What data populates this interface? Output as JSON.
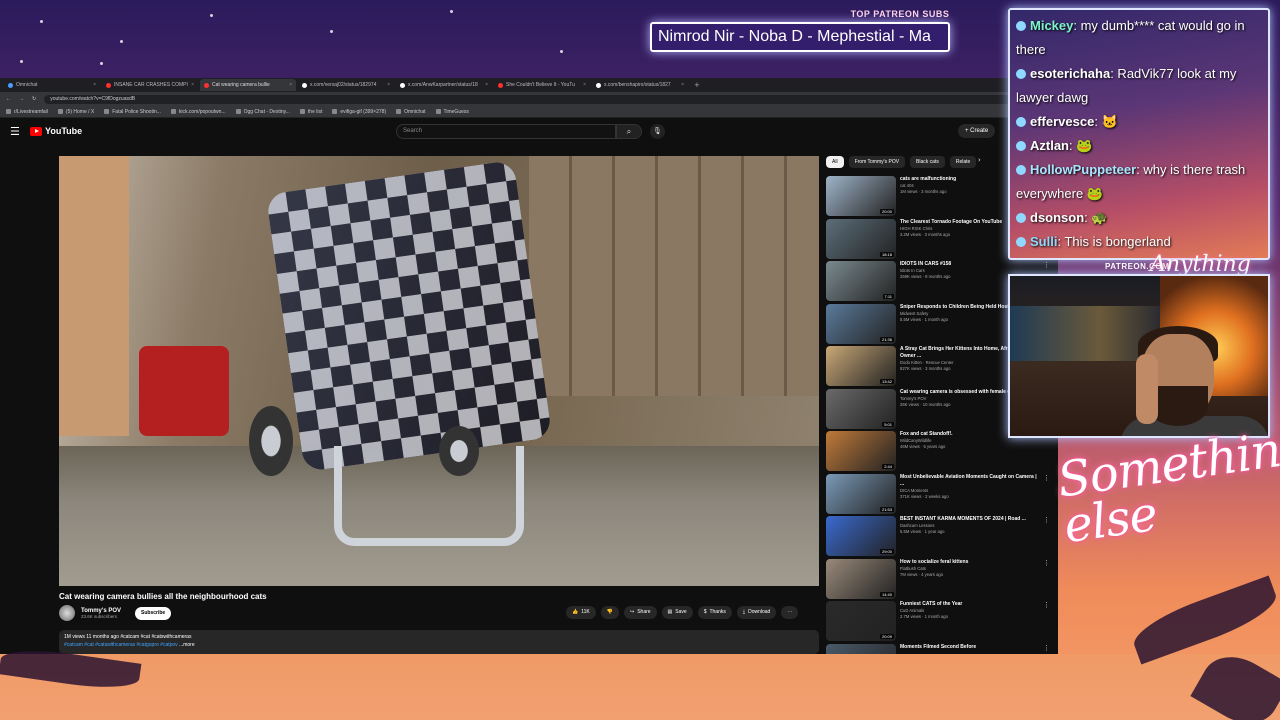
{
  "overlay": {
    "patreon_heading": "TOP PATREON SUBS",
    "patreon_names": "Nimrod Nir - Noba D - Mephestial - Ma",
    "patreon_url": "PATREON.COM/",
    "signature": "Something else",
    "signature_small": "Anything else?"
  },
  "browser": {
    "tabs": [
      {
        "label": "Omnichat",
        "icon": "globe-icon",
        "active": false
      },
      {
        "label": "INSANE CAR CRASHES COMPI",
        "icon": "youtube-icon",
        "active": false
      },
      {
        "label": "Cat wearing camera bullie",
        "icon": "youtube-icon",
        "active": true
      },
      {
        "label": "x.com/versaj02/status/182974",
        "icon": "x-icon",
        "active": false
      },
      {
        "label": "x.com/AnwKarpartner/status/18",
        "icon": "x-icon",
        "active": false
      },
      {
        "label": "She Couldn't Believe It - YouTu",
        "icon": "youtube-icon",
        "active": false
      },
      {
        "label": "x.com/benshapiro/status/1827",
        "icon": "x-icon",
        "active": false
      }
    ],
    "url": "youtube.com/watch?v=C9fDogzuasdB",
    "bookmarks": [
      "r/Livestreamfail",
      "(5) Home / X",
      "Fatal Police Shootin...",
      "kick.com/popoutwn...",
      "Ogg Chat - Destiny...",
      "the list",
      "evifiga-gif (399×278)",
      "Omnichat",
      "TimeGuess"
    ]
  },
  "youtube": {
    "logo": "YouTube",
    "search_placeholder": "Search",
    "create_label": "Create",
    "video_title": "Cat wearing camera bullies all the neighbourhood cats",
    "channel_name": "Tommy's POV",
    "channel_subs": "23.6K subscribers",
    "subscribe_label": "Subscribe",
    "actions": {
      "likes": "11K",
      "share": "Share",
      "save": "Save",
      "thanks": "Thanks",
      "download": "Download"
    },
    "description_meta": "1M views  11 months ago  #catcam #cat #catswithcameras",
    "description_tags": "#catcam #cat #catswithcameras #catgopro #catpov",
    "description_more": "...more",
    "chips": [
      "All",
      "From Tommy's POV",
      "Black cats",
      "Relate"
    ],
    "recommendations": [
      {
        "title": "cats are malfunctioning",
        "channel": "cat 404",
        "meta": "1M views · 3 months ago",
        "duration": "20:00",
        "color": "#9fb4c8"
      },
      {
        "title": "The Clearest Tornado Footage On YouTube",
        "channel": "HIGH RISK Chris",
        "meta": "3.2M views · 3 months ago",
        "duration": "18:18",
        "color": "#5c6e7a"
      },
      {
        "title": "IDIOTS IN CARS #158",
        "channel": "Idiots In Cars",
        "meta": "259K views · 8 months ago",
        "duration": "7:11",
        "color": "#7a8a8f"
      },
      {
        "title": "Sniper Responds to Children Being Held Hostage",
        "channel": "Midwest Safety",
        "meta": "5.5M views · 1 month ago",
        "duration": "21:36",
        "color": "#5a7a9a"
      },
      {
        "title": "A Stray Cat Brings Her Kittens Into Home, Afraid The Owner ...",
        "channel": "Dodo Kitten · Rescue Center",
        "meta": "827K views · 3 months ago",
        "duration": "13:42",
        "color": "#c9a877"
      },
      {
        "title": "Cat wearing camera is obsessed with female cat",
        "channel": "Tommy's POV",
        "meta": "26K views · 10 months ago",
        "duration": "5:01",
        "color": "#6a6a6a"
      },
      {
        "title": "Fox and cat Standoff!.",
        "channel": "WildCanyWildlife",
        "meta": "46M views · 5 years ago",
        "duration": "2:44",
        "color": "#c07a3a"
      },
      {
        "title": "Most Unbelievable Aviation Moments Caught on Camera | ...",
        "channel": "DICA Moments",
        "meta": "371K views · 2 weeks ago",
        "duration": "21:53",
        "color": "#7a9ab8"
      },
      {
        "title": "BEST INSTANT KARMA MOMENTS OF 2024 | Road ...",
        "channel": "Dashcam Lessons",
        "meta": "5.5M views · 1 year ago",
        "duration": "29:00",
        "color": "#3a6ad0"
      },
      {
        "title": "How to socialize feral kittens",
        "channel": "Flatbush Cats",
        "meta": "7M views · 4 years ago",
        "duration": "14:40",
        "color": "#9a8a7a"
      },
      {
        "title": "Funniest CATS of the Year",
        "channel": "CuD Animals",
        "meta": "2.7M views · 1 month ago",
        "duration": "20:09",
        "color": "#2a2a2a"
      },
      {
        "title": "Moments Filmed Second Before",
        "channel": "",
        "meta": "",
        "duration": "",
        "color": "#4a5a6a"
      }
    ]
  },
  "chat": {
    "messages": [
      {
        "user": "Mickey",
        "text": ": my dumb**** cat would go in there",
        "color": "#7cf5c8"
      },
      {
        "user": "esoterichaha",
        "text": ": RadVik77 look at my lawyer dawg",
        "color": "#ffffff"
      },
      {
        "user": "effervesce",
        "text": ": 🐱",
        "color": "#ffffff"
      },
      {
        "user": "Aztlan",
        "text": ": 🐸",
        "color": "#ffffff"
      },
      {
        "user": "HollowPuppeteer",
        "text": ": why is there trash everywhere 🐸",
        "color": "#a8e6ff"
      },
      {
        "user": "dsonson",
        "text": ": 🐢",
        "color": "#ffffff"
      },
      {
        "user": "Sulli",
        "text": ": This is bongerland",
        "color": "#8fd8ff"
      }
    ]
  }
}
